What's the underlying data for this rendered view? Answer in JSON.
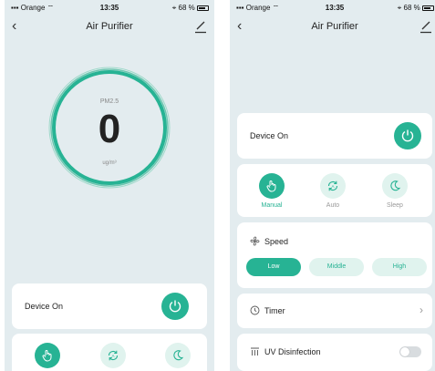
{
  "status_bar": {
    "carrier": "Orange",
    "time": "13:35",
    "battery": "68 %"
  },
  "header": {
    "title": "Air Purifier"
  },
  "gauge": {
    "label": "PM2.5",
    "value": "0",
    "unit": "ug/m³"
  },
  "device": {
    "label": "Device On",
    "power_on": true
  },
  "modes": [
    {
      "label": "Manual",
      "icon": "hand-icon",
      "active": true
    },
    {
      "label": "Auto",
      "icon": "auto-icon",
      "active": false
    },
    {
      "label": "Sleep",
      "icon": "moon-icon",
      "active": false
    }
  ],
  "speed": {
    "label": "Speed",
    "options": [
      "Low",
      "Middle",
      "High"
    ],
    "selected": "Low"
  },
  "timer": {
    "label": "Timer"
  },
  "uv": {
    "label": "UV Disinfection",
    "on": false
  },
  "colors": {
    "accent": "#27b394",
    "accent_light": "#e0f3ee",
    "background": "#e3ecef",
    "card": "#ffffff"
  }
}
